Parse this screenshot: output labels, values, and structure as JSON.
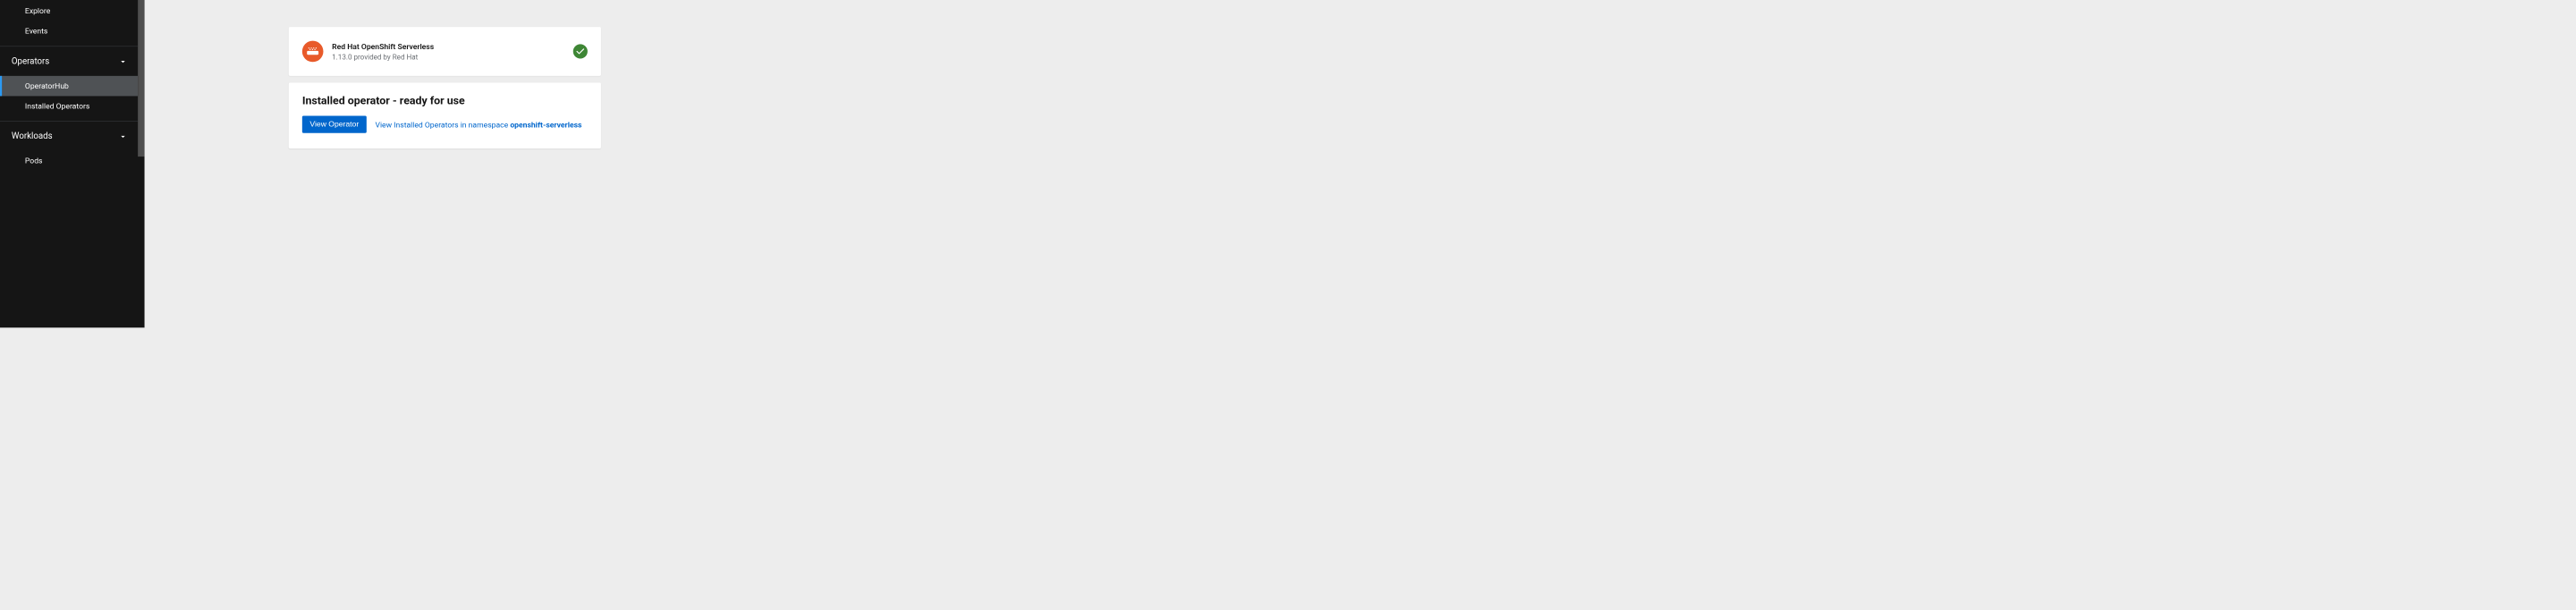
{
  "sidebar": {
    "items_top": [
      {
        "label": "Explore"
      },
      {
        "label": "Events"
      }
    ],
    "sections": [
      {
        "label": "Operators",
        "items": [
          {
            "label": "OperatorHub",
            "active": true
          },
          {
            "label": "Installed Operators"
          }
        ]
      },
      {
        "label": "Workloads",
        "items": [
          {
            "label": "Pods"
          }
        ]
      }
    ]
  },
  "operator_card": {
    "title": "Red Hat OpenShift Serverless",
    "subtitle": "1.13.0 provided by Red Hat"
  },
  "status_card": {
    "title": "Installed operator - ready for use",
    "button_label": "View Operator",
    "link_prefix": "View Installed Operators in namespace ",
    "link_namespace": "openshift-serverless"
  }
}
